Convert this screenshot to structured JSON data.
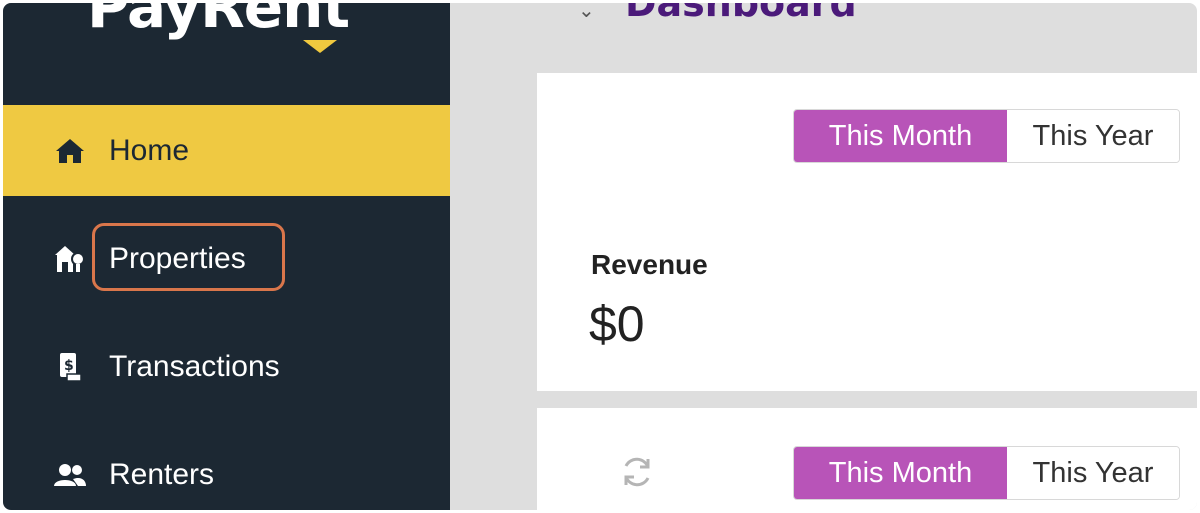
{
  "app": {
    "logo_text": "PayRent"
  },
  "sidebar": {
    "items": [
      {
        "label": "Home",
        "icon": "home-icon",
        "active": true
      },
      {
        "label": "Properties",
        "icon": "properties-icon",
        "active": false
      },
      {
        "label": "Transactions",
        "icon": "transactions-icon",
        "active": false
      },
      {
        "label": "Renters",
        "icon": "renters-icon",
        "active": false
      }
    ]
  },
  "main": {
    "title": "Dashboard",
    "revenue_card": {
      "toggle": {
        "this_month": "This Month",
        "this_year": "This Year",
        "selected": "This Month"
      },
      "label": "Revenue",
      "value": "$0"
    },
    "second_card": {
      "toggle": {
        "this_month": "This Month",
        "this_year": "This Year",
        "selected": "This Month"
      },
      "icon": "refresh-icon"
    }
  },
  "colors": {
    "sidebar_bg": "#1c2833",
    "active_nav": "#efc942",
    "toggle_active": "#b854b8",
    "title": "#4b1a7a",
    "highlight": "#d9764b"
  }
}
